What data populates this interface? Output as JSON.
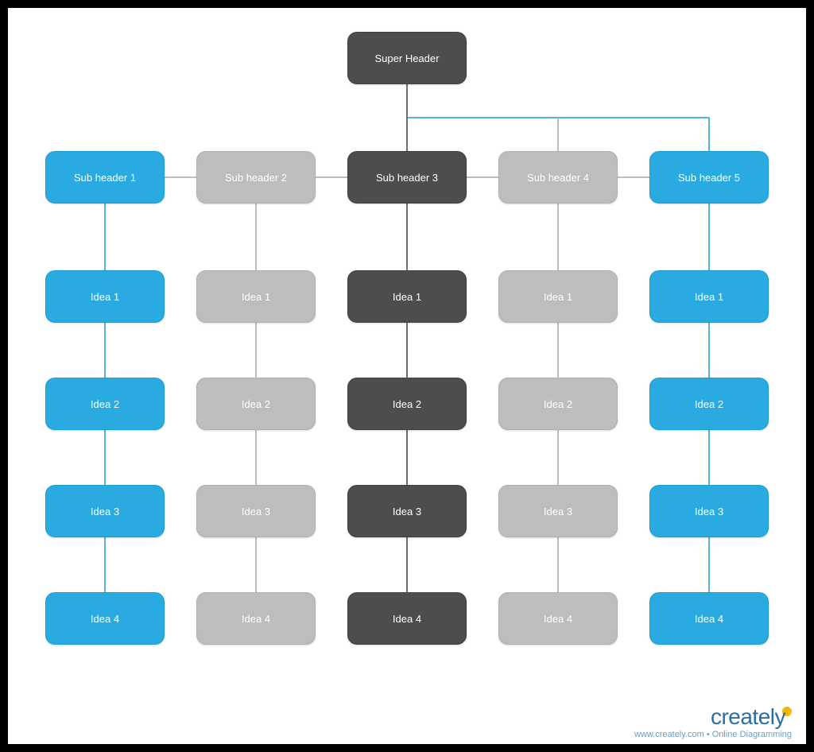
{
  "footer": {
    "brand": "creately",
    "tagline": "www.creately.com • Online Diagramming"
  },
  "diagram": {
    "super_header": "Super Header",
    "columns": [
      {
        "color": "blue",
        "line_color": "#1d9cd3",
        "header": "Sub header 1",
        "ideas": [
          "Idea 1",
          "Idea 2",
          "Idea 3",
          "Idea 4"
        ]
      },
      {
        "color": "grey",
        "line_color": "#a8a8a8",
        "header": "Sub header 2",
        "ideas": [
          "Idea 1",
          "Idea 2",
          "Idea 3",
          "Idea 4"
        ]
      },
      {
        "color": "dark",
        "line_color": "#3f3f3f",
        "header": "Sub header 3",
        "ideas": [
          "Idea 1",
          "Idea 2",
          "Idea 3",
          "Idea 4"
        ]
      },
      {
        "color": "grey",
        "line_color": "#a8a8a8",
        "header": "Sub header 4",
        "ideas": [
          "Idea 1",
          "Idea 2",
          "Idea 3",
          "Idea 4"
        ]
      },
      {
        "color": "blue",
        "line_color": "#1d9cd3",
        "header": "Sub header 5",
        "ideas": [
          "Idea 1",
          "Idea 2",
          "Idea 3",
          "Idea 4"
        ]
      }
    ]
  }
}
